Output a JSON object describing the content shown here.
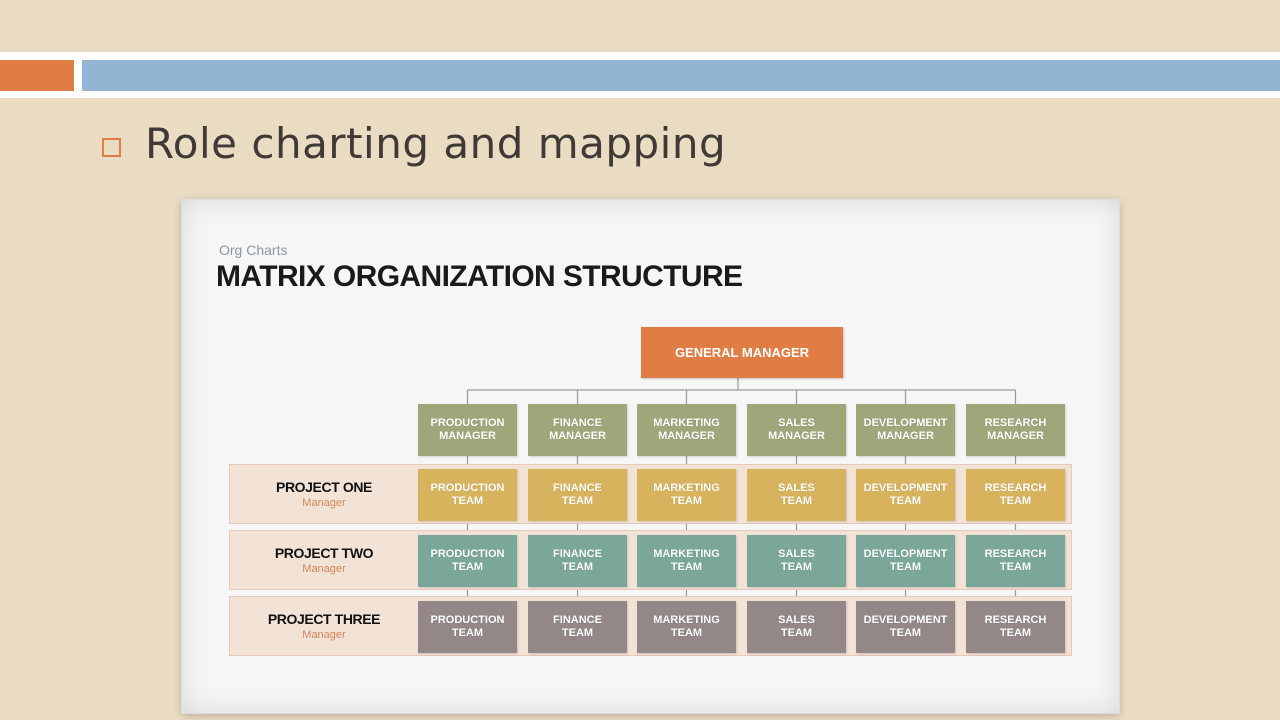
{
  "slide": {
    "title": "Role charting and mapping",
    "colors": {
      "accent_orange": "#e07d45",
      "accent_blue": "#93b4d2",
      "background": "#eadcc2"
    }
  },
  "chart": {
    "subtitle": "Org Charts",
    "title": "MATRIX ORGANIZATION STRUCTURE",
    "top_node": "GENERAL MANAGER",
    "managers": [
      "PRODUCTION\nMANAGER",
      "FINANCE\nMANAGER",
      "MARKETING\nMANAGER",
      "SALES\nMANAGER",
      "DEVELOPMENT\nMANAGER",
      "RESEARCH\nMANAGER"
    ],
    "rows": [
      {
        "name": "PROJECT ONE",
        "role": "Manager",
        "color": "#d8b35e",
        "teams": [
          "PRODUCTION\nTEAM",
          "FINANCE\nTEAM",
          "MARKETING\nTEAM",
          "SALES\nTEAM",
          "DEVELOPMENT\nTEAM",
          "RESEARCH\nTEAM"
        ]
      },
      {
        "name": "PROJECT TWO",
        "role": "Manager",
        "color": "#7aa79a",
        "teams": [
          "PRODUCTION\nTEAM",
          "FINANCE\nTEAM",
          "MARKETING\nTEAM",
          "SALES\nTEAM",
          "DEVELOPMENT\nTEAM",
          "RESEARCH\nTEAM"
        ]
      },
      {
        "name": "PROJECT THREE",
        "role": "Manager",
        "color": "#938787",
        "teams": [
          "PRODUCTION\nTEAM",
          "FINANCE\nTEAM",
          "MARKETING\nTEAM",
          "SALES\nTEAM",
          "DEVELOPMENT\nTEAM",
          "RESEARCH\nTEAM"
        ]
      }
    ],
    "colors": {
      "general_manager": "#e07d45",
      "manager": "#9fa67a",
      "row_band": "#f3e2d6"
    }
  }
}
